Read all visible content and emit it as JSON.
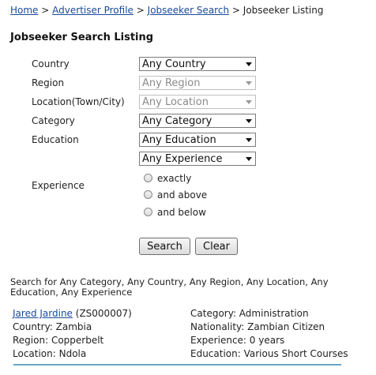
{
  "breadcrumb": {
    "items": [
      "Home",
      "Advertiser Profile",
      "Jobseeker Search"
    ],
    "separator": ">",
    "current": "Jobseeker Listing"
  },
  "title": "Jobseeker Search Listing",
  "form": {
    "country": {
      "label": "Country",
      "value": "Any Country"
    },
    "region": {
      "label": "Region",
      "value": "Any Region",
      "disabled": true
    },
    "location": {
      "label": "Location(Town/City)",
      "value": "Any Location",
      "disabled": true
    },
    "category": {
      "label": "Category",
      "value": "Any Category"
    },
    "education": {
      "label": "Education",
      "value": "Any Education"
    },
    "experience": {
      "label": "Experience",
      "value": "Any Experience",
      "options": [
        "exactly",
        "and above",
        "and below"
      ]
    },
    "search_label": "Search",
    "clear_label": "Clear"
  },
  "summary": "Search for Any Category, Any Country, Any Region, Any Location, Any Education, Any Experience",
  "result": {
    "name": "Jared Jardine",
    "id": "(ZS000007)",
    "country": "Country: Zambia",
    "region": "Region: Copperbelt",
    "location": "Location: Ndola",
    "category": "Category: Administration",
    "nationality": "Nationality: Zambian Citizen",
    "experience": "Experience: 0 years",
    "education": "Education: Various Short Courses"
  },
  "colors": {
    "link": "#1a4a9a",
    "divider": "#6aa6c8"
  }
}
